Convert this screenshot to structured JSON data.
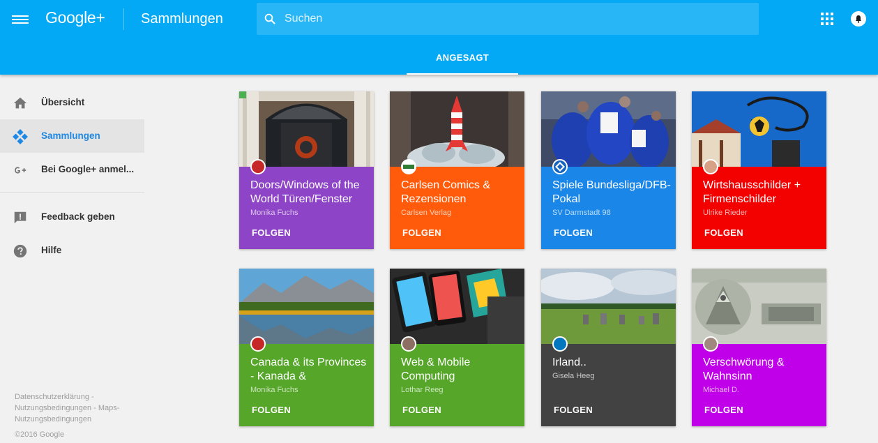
{
  "header": {
    "logo_text": "Google+",
    "page_title": "Sammlungen",
    "search_placeholder": "Suchen",
    "tab_label": "ANGESAGT",
    "color": "#03a9f4"
  },
  "sidebar": {
    "items": [
      {
        "label": "Übersicht",
        "icon": "home-icon"
      },
      {
        "label": "Sammlungen",
        "icon": "collections-icon",
        "active": true
      },
      {
        "label": "Bei Google+ anmel...",
        "icon": "google-plus-icon"
      },
      {
        "label": "Feedback geben",
        "icon": "feedback-icon"
      },
      {
        "label": "Hilfe",
        "icon": "help-icon"
      }
    ],
    "footer_links": "Datenschutzerklärung - Nutzungsbedingungen - Maps-Nutzungsbedingungen",
    "copyright": "©2016 Google"
  },
  "cards": [
    {
      "title": "Doors/Windows of the World Türen/Fenster",
      "owner": "Monika Fuchs",
      "follow": "FOLGEN",
      "color": "#8e44c7"
    },
    {
      "title": "Carlsen Comics & Rezensionen",
      "owner": "Carlsen Verlag",
      "follow": "FOLGEN",
      "color": "#ff5b0a"
    },
    {
      "title": "Spiele Bundesliga/DFB-Pokal",
      "owner": "SV Darmstadt 98",
      "follow": "FOLGEN",
      "color": "#1a86e8"
    },
    {
      "title": "Wirtshausschilder + Firmenschilder",
      "owner": "Ulrike Rieder",
      "follow": "FOLGEN",
      "color": "#f30000"
    },
    {
      "title": "Canada & its Provinces - Kanada &",
      "owner": "Monika Fuchs",
      "follow": "FOLGEN",
      "color": "#55a629"
    },
    {
      "title": "Web & Mobile Computing",
      "owner": "Lothar Reeg",
      "follow": "FOLGEN",
      "color": "#55a629"
    },
    {
      "title": "Irland..",
      "owner": "Gisela Heeg",
      "follow": "FOLGEN",
      "color": "#424242"
    },
    {
      "title": "Verschwörung & Wahnsinn",
      "owner": "Michael D.",
      "follow": "FOLGEN",
      "color": "#c000e8"
    }
  ]
}
